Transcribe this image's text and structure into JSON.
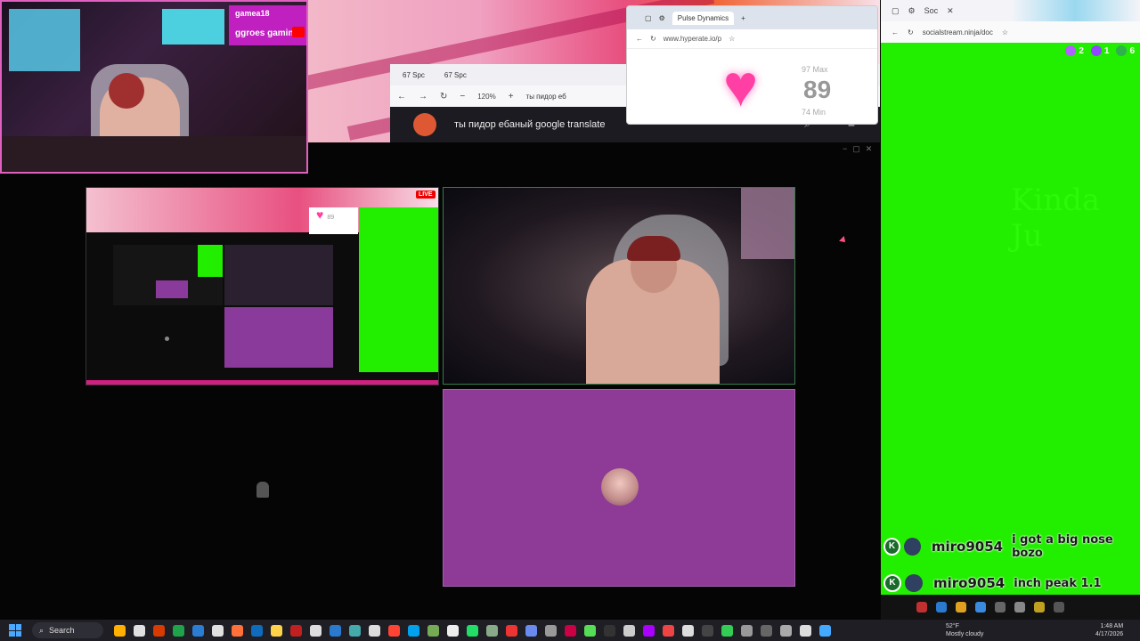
{
  "webcam": {
    "handle": "gamea18",
    "channel": "ggroes gaming"
  },
  "ddg": {
    "tabs": [
      "67 Spc",
      "67 Spc"
    ],
    "zoom": "120%",
    "url_snippet": "ты пидор еб",
    "query": "ты пидор ебаный google translate"
  },
  "pulse": {
    "tab_title": "Pulse Dynamics",
    "url": "www.hyperate.io/p",
    "max_label": "97 Max",
    "bpm": "89",
    "min_label": "74 Min"
  },
  "nested": {
    "live_badge": "LIVE",
    "heart_value": "89"
  },
  "right_browser": {
    "tab": "Soc",
    "url": "socialstream.ninja/doc"
  },
  "counters": [
    {
      "value": "2",
      "color": "#b060ff"
    },
    {
      "value": "1",
      "color": "#9146ff"
    },
    {
      "value": "6",
      "color": "#2fb24c"
    }
  ],
  "ghost_text": "Kinda Ju",
  "chat": [
    {
      "user": "miro9054",
      "message": "i got a big nose bozo"
    },
    {
      "user": "miro9054",
      "message": "inch peak 1.1"
    }
  ],
  "taskbar": {
    "search_label": "Search",
    "weather_temp": "52°F",
    "weather_desc": "Mostly cloudy",
    "time": "1:48 AM",
    "date": "4/17/2026",
    "app_colors": [
      "#ffb000",
      "#e0e0e0",
      "#d83b01",
      "#1fa34a",
      "#2b7cd3",
      "#e0e0e0",
      "#ff7139",
      "#0f6cbd",
      "#ffd24a",
      "#c02020",
      "#ddd",
      "#2a7ad0",
      "#4aa",
      "#ddd",
      "#f43",
      "#00a2ed",
      "#7a5",
      "#eee",
      "#2d6",
      "#8a8",
      "#e33",
      "#6a8af0",
      "#999",
      "#c04",
      "#5d5",
      "#333",
      "#ccc",
      "#a0f",
      "#e44",
      "#ddd",
      "#444",
      "#3c5",
      "#999",
      "#666",
      "#aaa",
      "#ddd",
      "#4af"
    ]
  }
}
